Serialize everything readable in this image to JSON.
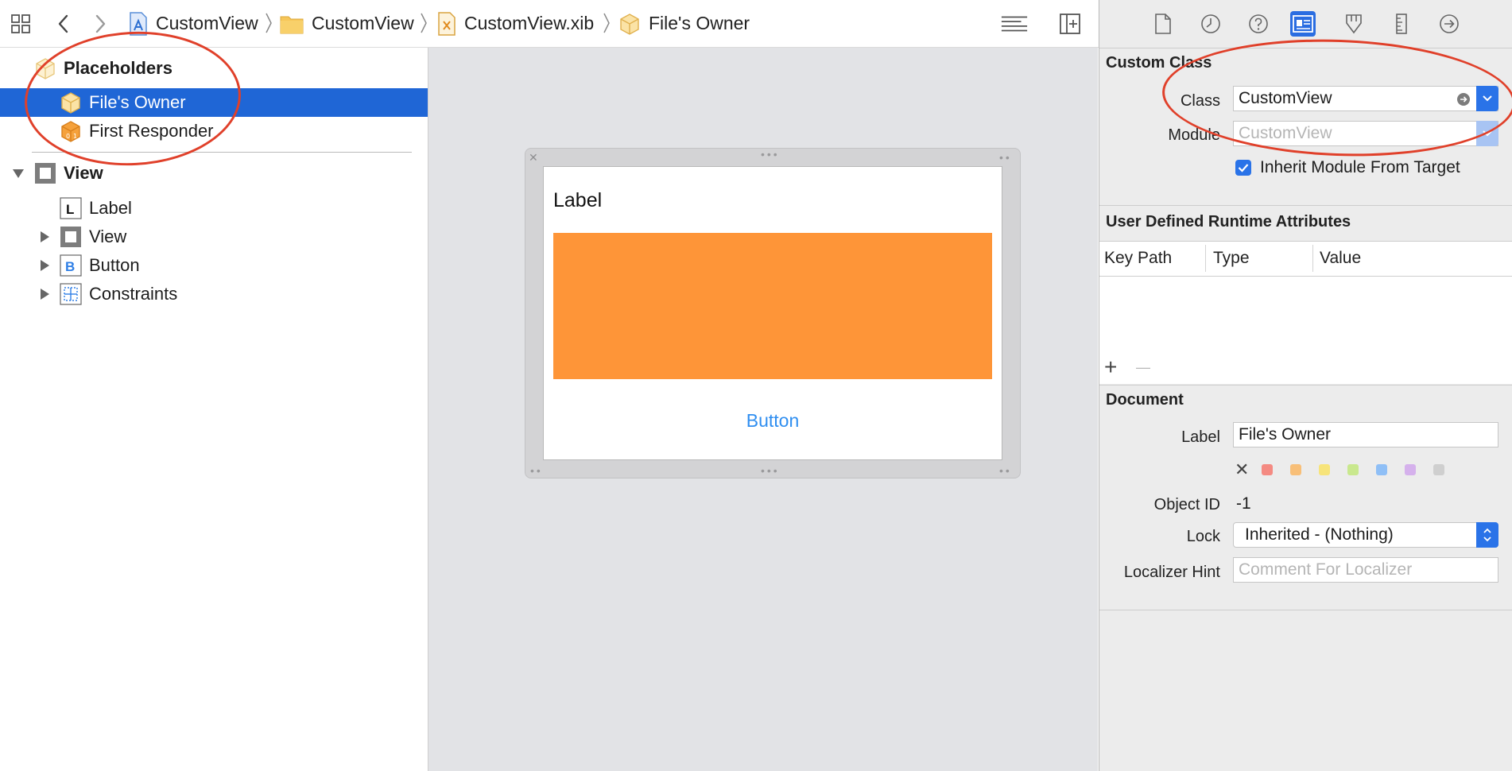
{
  "breadcrumb": {
    "items": [
      {
        "label": "CustomView",
        "icon": "xcode-project-icon"
      },
      {
        "label": "CustomView",
        "icon": "folder-icon"
      },
      {
        "label": "CustomView.xib",
        "icon": "xib-file-icon"
      },
      {
        "label": "File's Owner",
        "icon": "placeholder-cube-icon"
      }
    ]
  },
  "outline": {
    "placeholders_label": "Placeholders",
    "files_owner_label": "File's Owner",
    "first_responder_label": "First Responder",
    "view_label": "View",
    "label_item": "Label",
    "subview_label": "View",
    "button_label": "Button",
    "constraints_label": "Constraints",
    "label_glyph": "L",
    "button_glyph": "B"
  },
  "canvas": {
    "label_text": "Label",
    "button_text": "Button",
    "orange_color": "#fe9538",
    "button_color": "#2f8ef0"
  },
  "inspector": {
    "custom_class": {
      "title": "Custom Class",
      "class_label": "Class",
      "class_value": "CustomView",
      "module_label": "Module",
      "module_placeholder": "CustomView",
      "inherit_label": "Inherit Module From Target",
      "inherit_checked": true
    },
    "runtime_attrs": {
      "title": "User Defined Runtime Attributes",
      "columns": [
        "Key Path",
        "Type",
        "Value"
      ],
      "add_symbol": "+",
      "remove_symbol": "—"
    },
    "document": {
      "title": "Document",
      "label_label": "Label",
      "label_value": "File's Owner",
      "clear_symbol": "✕",
      "swatch_colors": [
        "#f48a82",
        "#f8bf78",
        "#f7e47a",
        "#c9e88e",
        "#8fbff6",
        "#d5b1ec",
        "#cfcfcf"
      ],
      "object_id_label": "Object ID",
      "object_id_value": "-1",
      "lock_label": "Lock",
      "lock_value": "Inherited - (Nothing)",
      "localizer_label": "Localizer Hint",
      "localizer_placeholder": "Comment For Localizer"
    }
  },
  "colors": {
    "selection": "#1f66d6",
    "accent": "#2a73e8",
    "annotation": "#e0402a"
  }
}
